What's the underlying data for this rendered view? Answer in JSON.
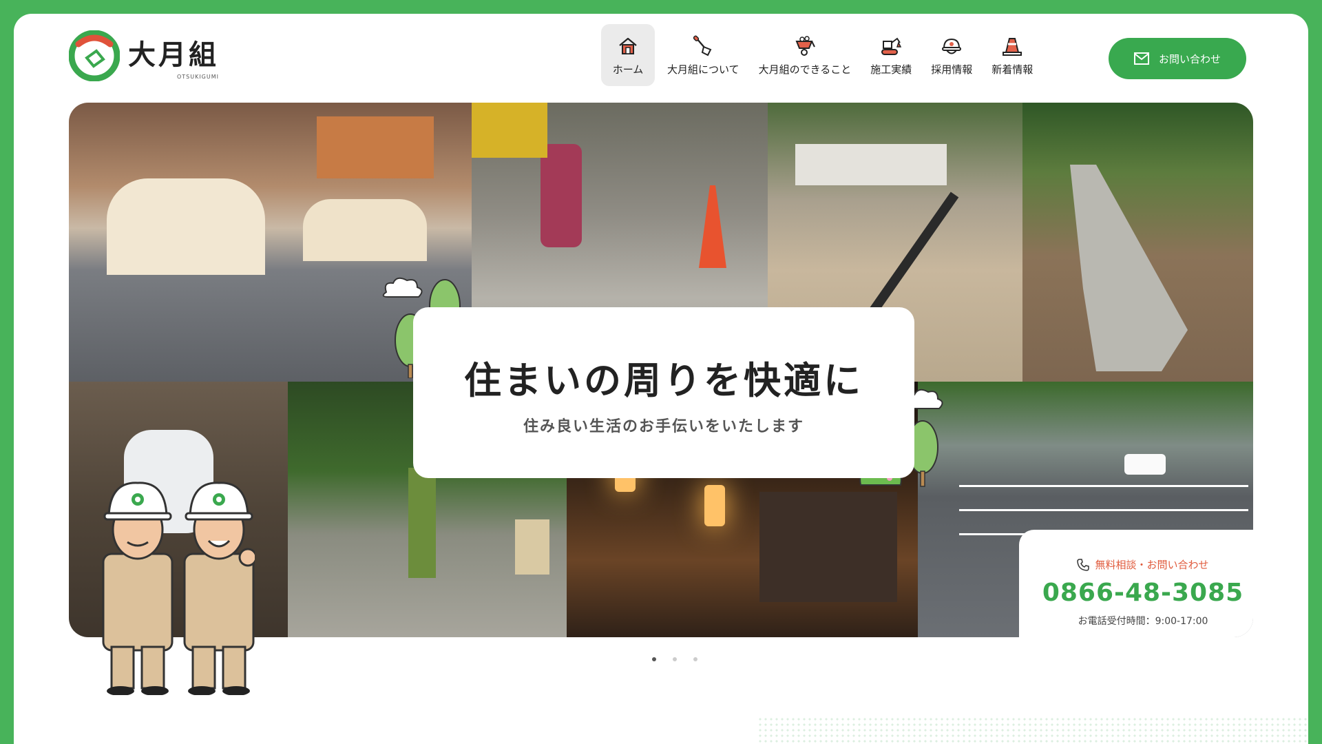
{
  "brand": {
    "name": "大月組",
    "sub": "OTSUKIGUMI",
    "color": "#3aa84e"
  },
  "nav": {
    "items": [
      {
        "label": "ホーム",
        "icon": "home-icon",
        "active": true
      },
      {
        "label": "大月組について",
        "icon": "shovel-icon"
      },
      {
        "label": "大月組のできること",
        "icon": "wheelbarrow-icon"
      },
      {
        "label": "施工実績",
        "icon": "excavator-icon"
      },
      {
        "label": "採用情報",
        "icon": "helmet-icon"
      },
      {
        "label": "新着情報",
        "icon": "traffic-cone-icon"
      }
    ],
    "contact_label": "お問い合わせ"
  },
  "hero": {
    "title": "住まいの周りを快適に",
    "subtitle": "住み良い生活のお手伝いをいたします"
  },
  "phone": {
    "heading": "無料相談・お問い合わせ",
    "number": "0866-48-3085",
    "hours": "お電話受付時間：9:00-17:00"
  },
  "carousel": {
    "slides": 3,
    "current": 1
  }
}
